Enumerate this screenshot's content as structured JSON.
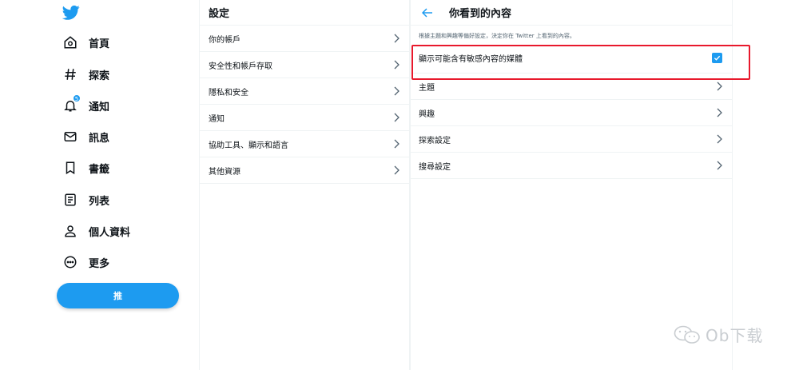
{
  "nav": {
    "items": [
      {
        "label": "首頁",
        "icon": "home-icon"
      },
      {
        "label": "探索",
        "icon": "hashtag-icon"
      },
      {
        "label": "通知",
        "icon": "bell-icon",
        "badge": "5"
      },
      {
        "label": "訊息",
        "icon": "envelope-icon"
      },
      {
        "label": "書籤",
        "icon": "bookmark-icon"
      },
      {
        "label": "列表",
        "icon": "list-icon"
      },
      {
        "label": "個人資料",
        "icon": "person-icon"
      },
      {
        "label": "更多",
        "icon": "more-icon"
      }
    ],
    "tweet_label": "推"
  },
  "settings": {
    "title": "設定",
    "items": [
      {
        "label": "你的帳戶"
      },
      {
        "label": "安全性和帳戶存取"
      },
      {
        "label": "隱私和安全"
      },
      {
        "label": "通知"
      },
      {
        "label": "協助工具、顯示和語言"
      },
      {
        "label": "其他資源"
      }
    ]
  },
  "content": {
    "title": "你看到的內容",
    "description": "根據主題和興趣等偏好設定，決定你在 Twitter 上看到的內容。",
    "sensitive_media_label": "顯示可能含有敏感內容的媒體",
    "sensitive_media_checked": true,
    "items": [
      {
        "label": "主題"
      },
      {
        "label": "興趣"
      },
      {
        "label": "探索設定"
      },
      {
        "label": "搜尋設定"
      }
    ]
  },
  "colors": {
    "accent": "#1d9bf0",
    "highlight": "#e8192c"
  },
  "watermark": {
    "text": "Ob下载"
  }
}
